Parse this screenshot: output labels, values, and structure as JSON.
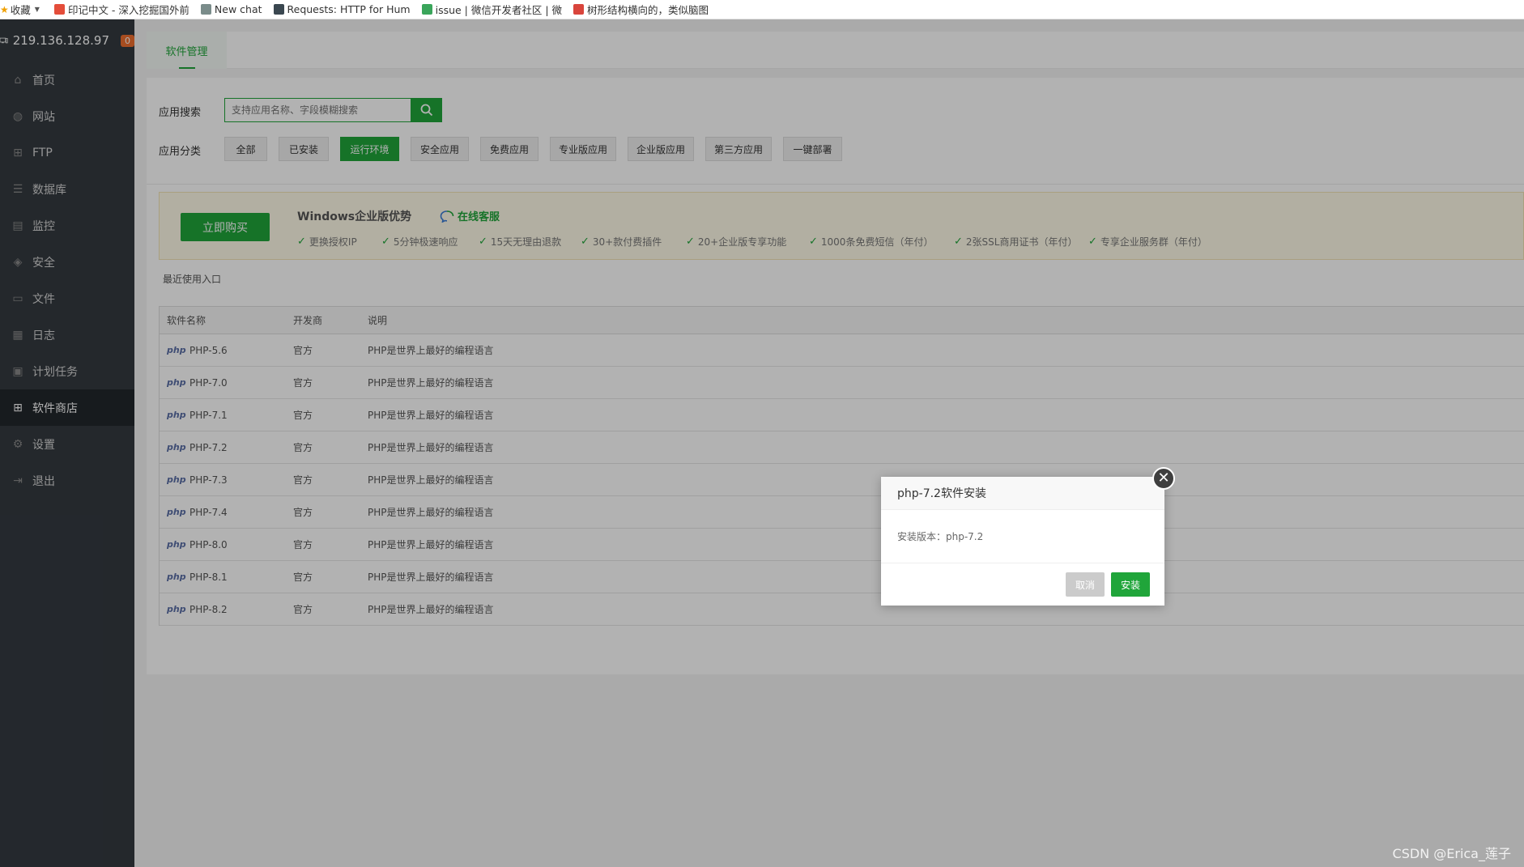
{
  "bookmarks": {
    "fav_label": "收藏",
    "items": [
      {
        "label": "印记中文 - 深入挖掘国外前",
        "color": "#e44d3a"
      },
      {
        "label": "New chat",
        "color": "#7a8c8a"
      },
      {
        "label": "Requests: HTTP for Hum",
        "color": "#3a4750"
      },
      {
        "label": "issue | 微信开发者社区 | 微",
        "color": "#3aa55b"
      },
      {
        "label": "树形结构横向的，类似脑图",
        "color": "#d9453c"
      }
    ]
  },
  "sidebar": {
    "server_ip": "219.136.128.97",
    "badge": "0",
    "items": [
      {
        "label": "首页",
        "icon": "home-icon",
        "glyph": "⌂"
      },
      {
        "label": "网站",
        "icon": "globe-icon",
        "glyph": "◍"
      },
      {
        "label": "FTP",
        "icon": "ftp-icon",
        "glyph": "⊞"
      },
      {
        "label": "数据库",
        "icon": "database-icon",
        "glyph": "☰"
      },
      {
        "label": "监控",
        "icon": "monitor-icon",
        "glyph": "▤"
      },
      {
        "label": "安全",
        "icon": "shield-icon",
        "glyph": "◈"
      },
      {
        "label": "文件",
        "icon": "folder-icon",
        "glyph": "▭"
      },
      {
        "label": "日志",
        "icon": "log-icon",
        "glyph": "▦"
      },
      {
        "label": "计划任务",
        "icon": "calendar-icon",
        "glyph": "▣"
      },
      {
        "label": "软件商店",
        "icon": "apps-icon",
        "glyph": "⊞"
      },
      {
        "label": "设置",
        "icon": "gear-icon",
        "glyph": "⚙"
      },
      {
        "label": "退出",
        "icon": "logout-icon",
        "glyph": "⇥"
      }
    ],
    "active_index": 9
  },
  "header": {
    "tab_label": "软件管理"
  },
  "search": {
    "label": "应用搜索",
    "placeholder": "支持应用名称、字段模糊搜索"
  },
  "categories": {
    "label": "应用分类",
    "items": [
      {
        "label": "全部",
        "w": 53
      },
      {
        "label": "已安装",
        "w": 62
      },
      {
        "label": "运行环境",
        "w": 73
      },
      {
        "label": "安全应用",
        "w": 72
      },
      {
        "label": "免费应用",
        "w": 72
      },
      {
        "label": "专业版应用",
        "w": 82
      },
      {
        "label": "企业版应用",
        "w": 82
      },
      {
        "label": "第三方应用",
        "w": 82
      },
      {
        "label": "一键部署",
        "w": 73
      }
    ],
    "active_index": 2
  },
  "promo": {
    "buy_label": "立即购买",
    "title": "Windows企业版优势",
    "service_label": "在线客服",
    "features": [
      "更换授权IP",
      "5分钟极速响应",
      "15天无理由退款",
      "30+款付费插件",
      "20+企业版专享功能",
      "1000条免费短信（年付）",
      "2张SSL商用证书（年付）",
      "专享企业服务群（年付）"
    ]
  },
  "recent_label": "最近使用入口",
  "table": {
    "headers": [
      "软件名称",
      "开发商",
      "说明"
    ],
    "logo_text": "php",
    "rows": [
      {
        "name": "PHP-5.6",
        "vendor": "官方",
        "desc": "PHP是世界上最好的编程语言"
      },
      {
        "name": "PHP-7.0",
        "vendor": "官方",
        "desc": "PHP是世界上最好的编程语言"
      },
      {
        "name": "PHP-7.1",
        "vendor": "官方",
        "desc": "PHP是世界上最好的编程语言"
      },
      {
        "name": "PHP-7.2",
        "vendor": "官方",
        "desc": "PHP是世界上最好的编程语言"
      },
      {
        "name": "PHP-7.3",
        "vendor": "官方",
        "desc": "PHP是世界上最好的编程语言"
      },
      {
        "name": "PHP-7.4",
        "vendor": "官方",
        "desc": "PHP是世界上最好的编程语言"
      },
      {
        "name": "PHP-8.0",
        "vendor": "官方",
        "desc": "PHP是世界上最好的编程语言"
      },
      {
        "name": "PHP-8.1",
        "vendor": "官方",
        "desc": "PHP是世界上最好的编程语言"
      },
      {
        "name": "PHP-8.2",
        "vendor": "官方",
        "desc": "PHP是世界上最好的编程语言"
      }
    ]
  },
  "dialog": {
    "title": "php-7.2软件安装",
    "version_text": "安装版本：php-7.2",
    "cancel_label": "取消",
    "install_label": "安装",
    "close_glyph": "✕"
  },
  "watermark": "CSDN @Erica_莲子",
  "colors": {
    "accent": "#20a53a",
    "sidebar_bg": "#343a40",
    "badge": "#ef6f2f"
  }
}
